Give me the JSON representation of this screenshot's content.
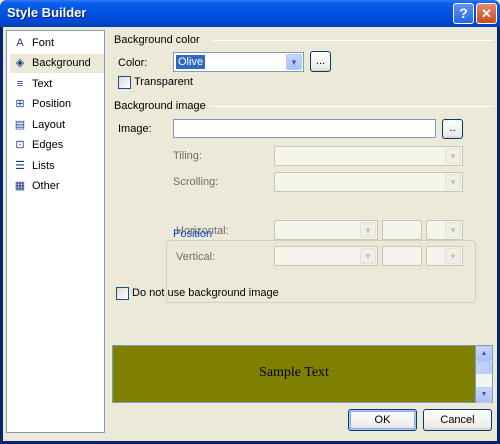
{
  "window": {
    "title": "Style Builder",
    "help_label": "?",
    "close_label": "✕"
  },
  "sidebar": {
    "items": [
      {
        "label": "Font",
        "icon": "font-icon",
        "glyph": "A"
      },
      {
        "label": "Background",
        "icon": "background-icon",
        "glyph": "◈",
        "active": true
      },
      {
        "label": "Text",
        "icon": "text-icon",
        "glyph": "≡"
      },
      {
        "label": "Position",
        "icon": "position-icon",
        "glyph": "⊞"
      },
      {
        "label": "Layout",
        "icon": "layout-icon",
        "glyph": "▤"
      },
      {
        "label": "Edges",
        "icon": "edges-icon",
        "glyph": "⊡"
      },
      {
        "label": "Lists",
        "icon": "lists-icon",
        "glyph": "☰"
      },
      {
        "label": "Other",
        "icon": "other-icon",
        "glyph": "▦"
      }
    ]
  },
  "background_color": {
    "heading": "Background color",
    "color_label": "Color:",
    "color_value": "Olive",
    "browse_label": "...",
    "transparent_label": "Transparent",
    "transparent_checked": false
  },
  "background_image": {
    "heading": "Background image",
    "image_label": "Image:",
    "image_value": "",
    "browse_label": "..",
    "tiling_label": "Tiling:",
    "scrolling_label": "Scrolling:",
    "position": {
      "heading": "Position",
      "horizontal_label": "Horizontal:",
      "vertical_label": "Vertical:"
    },
    "no_image_label": "Do not use background image",
    "no_image_checked": false
  },
  "preview": {
    "sample_text": "Sample Text",
    "color": "#808000"
  },
  "buttons": {
    "ok": "OK",
    "cancel": "Cancel"
  }
}
